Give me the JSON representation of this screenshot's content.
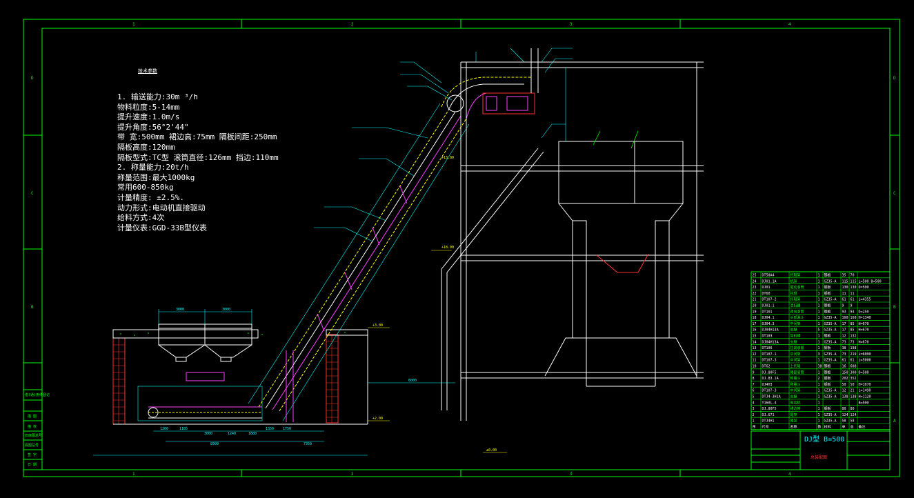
{
  "drawing": {
    "frame_columns": [
      "1",
      "2",
      "3",
      "4"
    ],
    "frame_rows_right": [
      "D",
      "C",
      "B",
      "A"
    ],
    "frame_rows_left": [
      "D",
      "C",
      "B"
    ],
    "spec_title": "技术参数",
    "spec_lines": [
      "1.  输送能力:30m   ³/h",
      "     物料粒度:5-14mm",
      "     提升速度:1.0m/s",
      "     提升角度:56°2'44\"",
      "     带    宽:500mm 裙边高:75mm 隔板间距:250mm",
      "     隔板高度:120mm",
      "     隔板型式:TC型  滚筒直径:126mm  挡边:110mm",
      "2.  称量能力:20t/h",
      "     称量范围:最大1000kg",
      "              常用600-850kg",
      "     计量精度:  ±2.5%.",
      "     动力形式:电动机直接驱动",
      "     给料方式:4次",
      "     计量仪表:GGD-33B型仪表"
    ],
    "title_block": {
      "drawing_no": "DJ型 B=500",
      "drawing_name": "总装配图"
    },
    "elevations": [
      "+3.00",
      "+13.00",
      "+2.00",
      "+18.00",
      "+0.00",
      "±0.00"
    ],
    "dimensions_bottom": [
      "1200",
      "1185",
      "3000",
      "1240",
      "1680",
      "1350",
      "1750",
      "1260",
      "8900",
      "7350"
    ],
    "dimensions_top": [
      "3000",
      "3000",
      "4300",
      "5300",
      "6000"
    ],
    "parts_list": [
      [
        "25",
        "DT50A4",
        "托辊架",
        "1",
        "钢板",
        "35",
        "70",
        ""
      ],
      [
        "24",
        "DJ01.1A",
        "机架",
        "1",
        "GZ35-A",
        "115",
        "115",
        "L=500 B=500"
      ],
      [
        "23",
        "DJ01",
        "驱动滚筒",
        "1",
        "钢板",
        "130",
        "130",
        "D=500"
      ],
      [
        "22",
        "DT60",
        "托辊",
        "1",
        "钢板",
        "11",
        "11",
        ""
      ],
      [
        "21",
        "DT107-2",
        "托辊架",
        "1",
        "GZ35-A",
        "61",
        "61",
        "L=4355"
      ],
      [
        "20",
        "DJ01.1",
        "清扫器",
        "1",
        "钢板",
        "9",
        "9",
        ""
      ],
      [
        "19",
        "DT101",
        "改向滚筒",
        "1",
        "钢板",
        "93",
        "93",
        "D=250"
      ],
      [
        "18",
        "DJ04.1",
        "头部漏斗",
        "1",
        "GZ35-A",
        "160",
        "160",
        "H=1340"
      ],
      [
        "17",
        "DJ04.3",
        "中间架",
        "1",
        "GZ35-A",
        "17",
        "85",
        "H=670"
      ],
      [
        "16",
        "DJ04H13A",
        "支腿",
        "5",
        "GZ35-A",
        "17",
        "85",
        "H=670"
      ],
      [
        "15",
        "DT103",
        "导料槽",
        "1",
        "钢板",
        "12",
        "132",
        ""
      ],
      [
        "14",
        "DJ04H13A",
        "支腿",
        "1",
        "GZ35-A",
        "73",
        "73",
        "H=670"
      ],
      [
        "13",
        "DT106",
        "拉紧装置",
        "1",
        "钢板",
        "38",
        "198",
        ""
      ],
      [
        "12",
        "DT107-1",
        "中间架",
        "3",
        "GZ35-A",
        "73",
        "219",
        "L=6000"
      ],
      [
        "11",
        "DT107-3",
        "中间架",
        "1",
        "GZ35-A",
        "61",
        "61",
        "L=5000"
      ],
      [
        "10",
        "DT62",
        "上托辊",
        "38",
        "钢板",
        "16",
        "608",
        ""
      ],
      [
        "9",
        "DJ.80F5",
        "尾部滚筒",
        "1",
        "钢板",
        "150",
        "300",
        "D=500"
      ],
      [
        "8",
        "DJ.B3.1A",
        "称量斗",
        "2",
        "钢板",
        "202",
        "352",
        ""
      ],
      [
        "7",
        "DJ4H3",
        "称量斗",
        "1",
        "钢板",
        "50",
        "50",
        "H=1070"
      ],
      [
        "6",
        "DT107-3",
        "中间架",
        "1",
        "GZ35-A",
        "12",
        "21",
        "L=1490"
      ],
      [
        "5",
        "DTJ4-3H1A",
        "支腿",
        "1",
        "GZ35-A",
        "138",
        "138",
        "H=1120"
      ],
      [
        "4",
        "Y160L-4",
        "电动机",
        "1",
        "",
        "",
        "",
        "B=500"
      ],
      [
        "3",
        "DJ.80F5",
        "裙边带",
        "1",
        "钢板",
        "80",
        "80",
        ""
      ],
      [
        "2",
        "DJ.671",
        "尾架",
        "1",
        "GZ35-A",
        "124",
        "124",
        ""
      ],
      [
        "1",
        "DTJ4H1",
        "尾架",
        "1",
        "GZ35-A",
        "58",
        "58",
        ""
      ]
    ],
    "parts_header": [
      "序",
      "代号",
      "名称",
      "数",
      "材料",
      "单",
      "总",
      "备注"
    ],
    "left_side_labels": [
      "借(通)用件登记",
      "",
      "",
      "描 图",
      "",
      "描 校",
      "",
      "旧底图总号",
      "",
      "底图总号",
      "",
      "签 字",
      "",
      "日 期"
    ]
  }
}
